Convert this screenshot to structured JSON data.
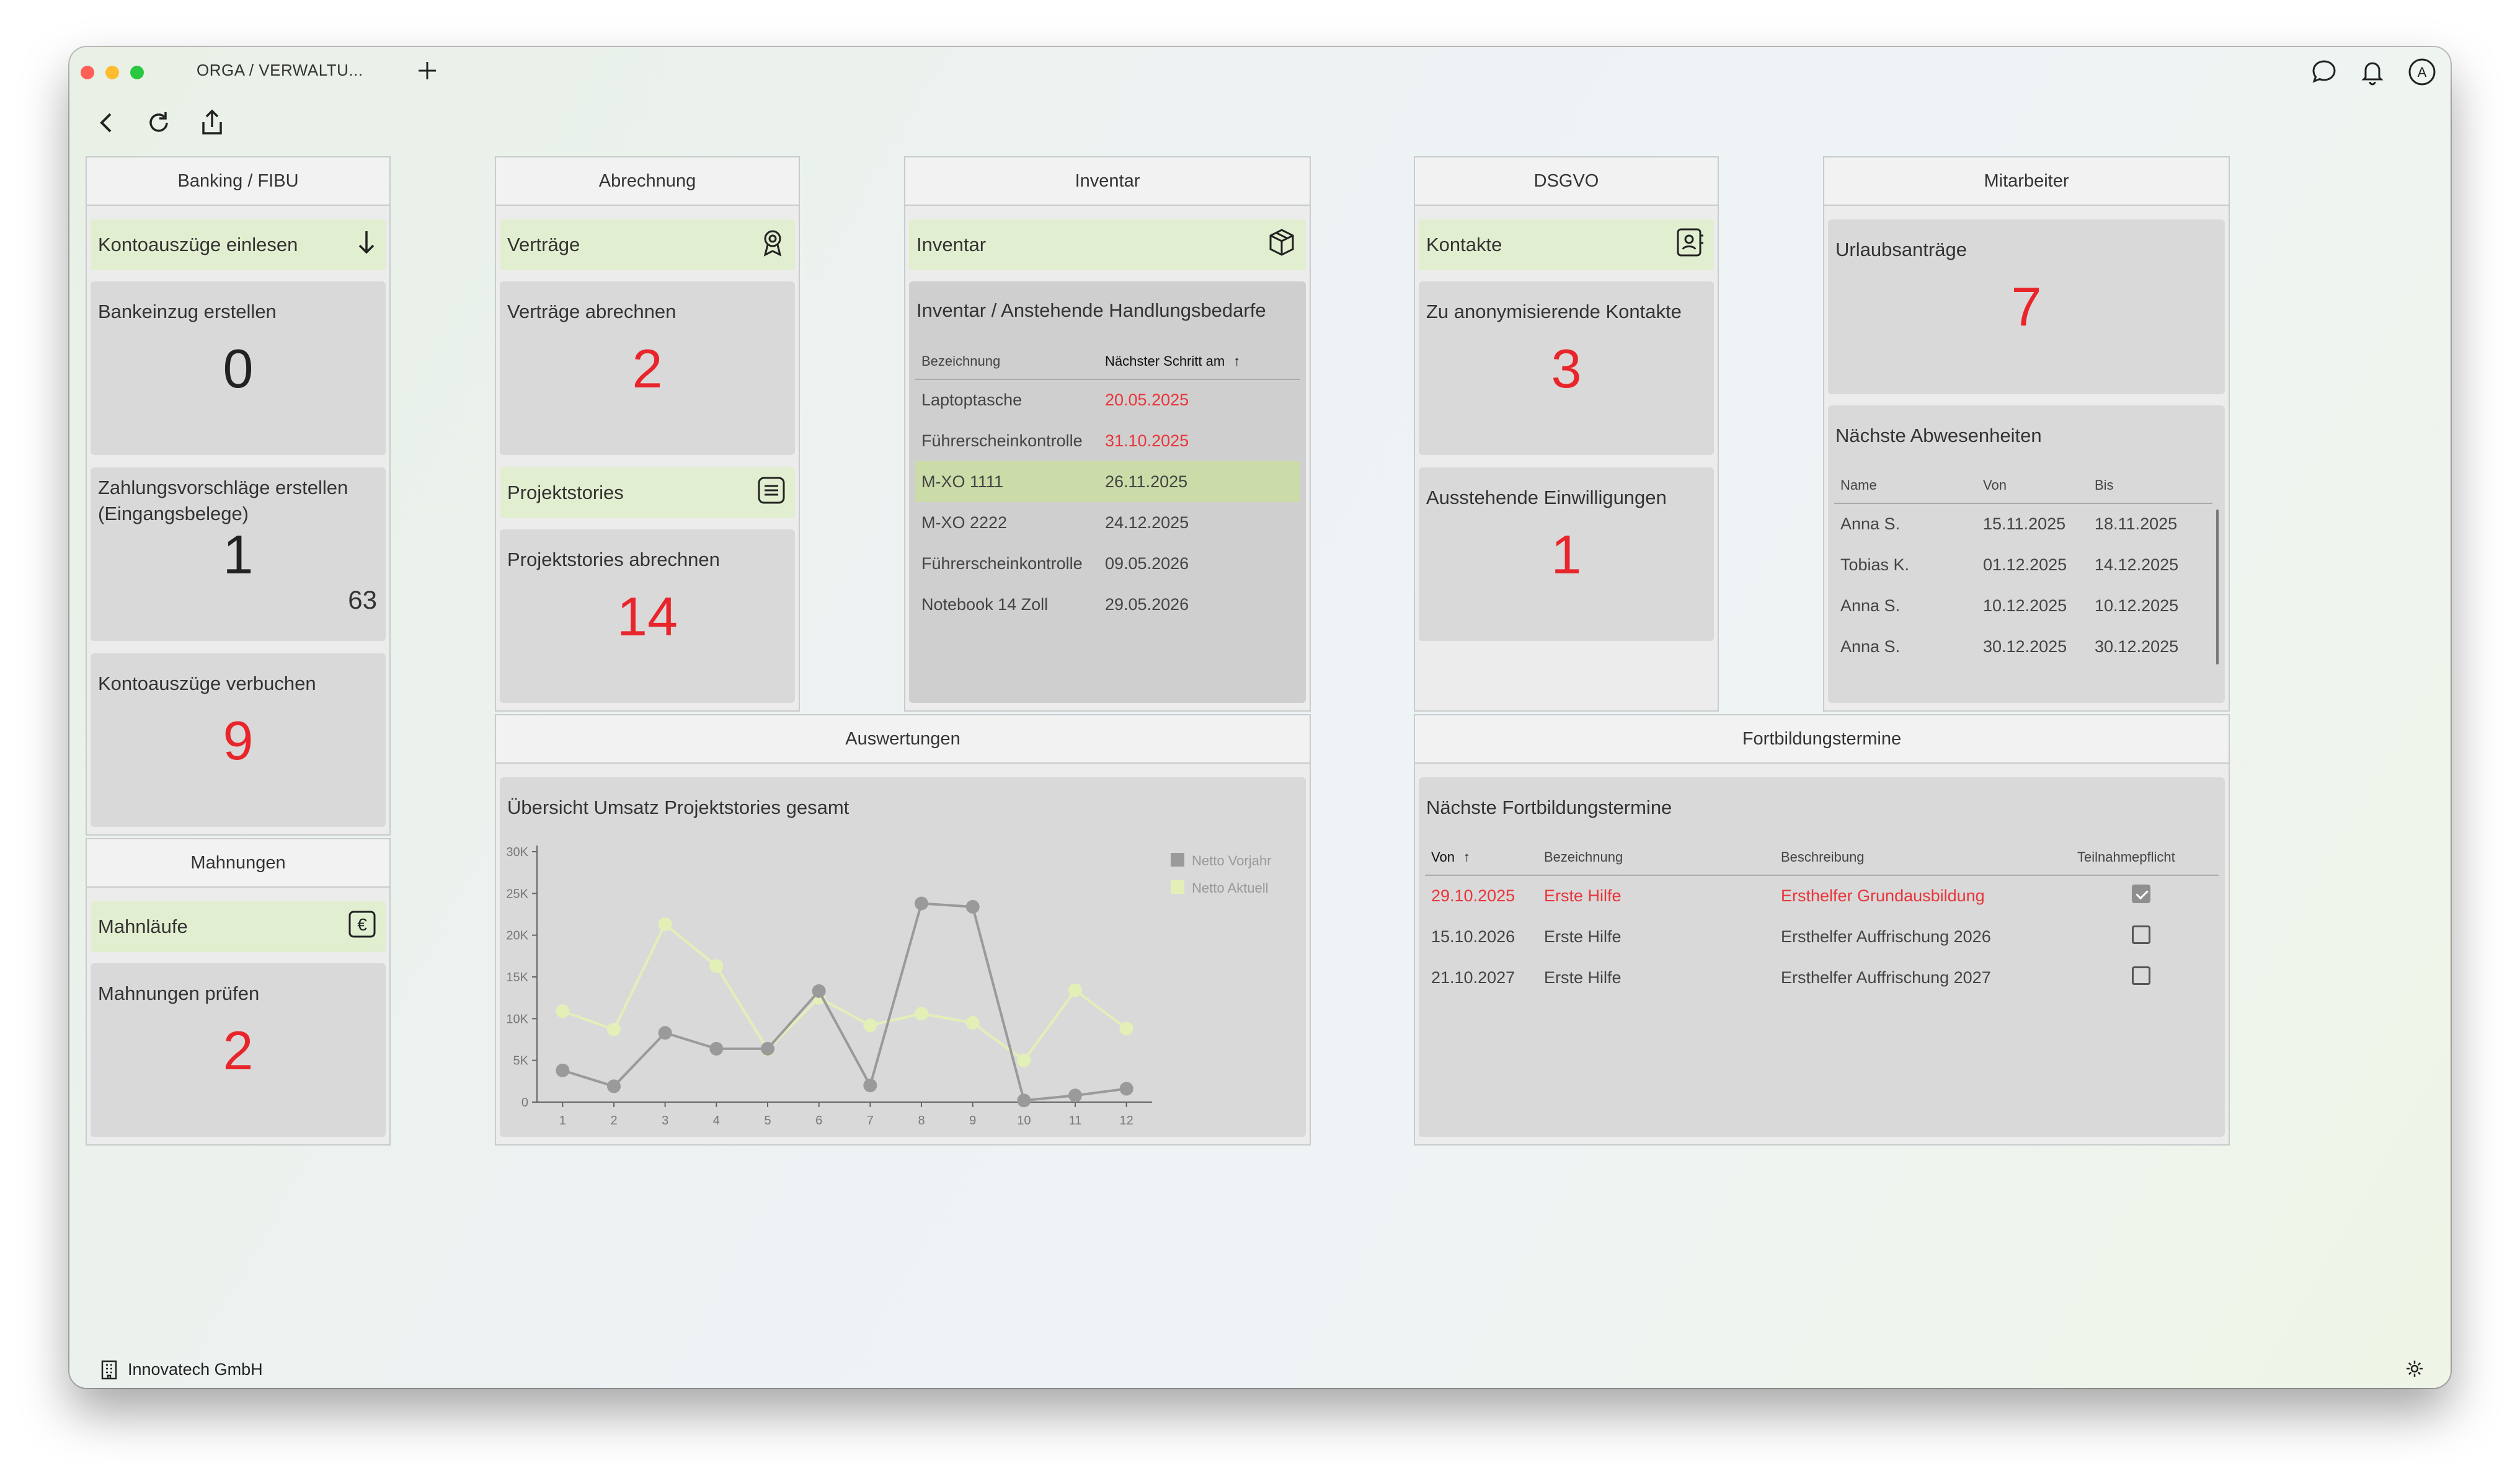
{
  "window": {
    "tab_title": "ORGA / VERWALTU...",
    "company": "Innovatech GmbH"
  },
  "banking": {
    "title": "Banking / FIBU",
    "action": "Kontoauszüge einlesen",
    "tiles": [
      {
        "label": "Bankeinzug erstellen",
        "value": "0"
      },
      {
        "label": "Zahlungsvorschläge erstellen\n(Eingangsbelege)",
        "value": "1",
        "sub": "63"
      },
      {
        "label": "Kontoauszüge verbuchen",
        "value": "9"
      }
    ]
  },
  "mahnungen": {
    "title": "Mahnungen",
    "action": "Mahnläufe",
    "tile": {
      "label": "Mahnungen prüfen",
      "value": "2"
    }
  },
  "abrechnung": {
    "title": "Abrechnung",
    "action1": "Verträge",
    "tile1": {
      "label": "Verträge abrechnen",
      "value": "2"
    },
    "action2": "Projektstories",
    "tile2": {
      "label": "Projektstories abrechnen",
      "value": "14"
    }
  },
  "inventar": {
    "title": "Inventar",
    "action": "Inventar",
    "panel_title": "Inventar / Anstehende Handlungsbedarfe",
    "columns": [
      "Bezeichnung",
      "Nächster Schritt am"
    ],
    "rows": [
      {
        "name": "Laptoptasche",
        "date": "20.05.2025",
        "overdue": true
      },
      {
        "name": "Führerscheinkontrolle",
        "date": "31.10.2025",
        "overdue": true
      },
      {
        "name": "M-XO 1111",
        "date": "26.11.2025",
        "highlight": true
      },
      {
        "name": "M-XO 2222",
        "date": "24.12.2025"
      },
      {
        "name": "Führerscheinkontrolle",
        "date": "09.05.2026"
      },
      {
        "name": "Notebook 14 Zoll",
        "date": "29.05.2026"
      }
    ]
  },
  "dsgvo": {
    "title": "DSGVO",
    "action": "Kontakte",
    "tile1": {
      "label": "Zu anonymisierende Kontakte",
      "value": "3"
    },
    "tile2": {
      "label": "Ausstehende Einwilligungen",
      "value": "1"
    }
  },
  "mitarbeiter": {
    "title": "Mitarbeiter",
    "tile1": {
      "label": "Urlaubsanträge",
      "value": "7"
    },
    "absences_title": "Nächste Abwesenheiten",
    "columns": [
      "Name",
      "Von",
      "Bis"
    ],
    "rows": [
      [
        "Anna S.",
        "15.11.2025",
        "18.11.2025"
      ],
      [
        "Tobias K.",
        "01.12.2025",
        "14.12.2025"
      ],
      [
        "Anna S.",
        "10.12.2025",
        "10.12.2025"
      ],
      [
        "Anna S.",
        "30.12.2025",
        "30.12.2025"
      ]
    ]
  },
  "auswertungen": {
    "title": "Auswertungen",
    "chart_title": "Übersicht Umsatz Projektstories gesamt"
  },
  "chart_data": {
    "type": "line",
    "title": "Übersicht Umsatz Projektstories gesamt",
    "x": [
      "1",
      "2",
      "3",
      "4",
      "5",
      "6",
      "7",
      "8",
      "9",
      "10",
      "11",
      "12"
    ],
    "y_ticks": [
      "0",
      "5K",
      "10K",
      "15K",
      "20K",
      "25K",
      "30K"
    ],
    "ylim": [
      0,
      30000
    ],
    "legend_position": "top-right",
    "series": [
      {
        "name": "Netto Vorjahr",
        "color": "#9a9a9a",
        "values": [
          3800,
          1900,
          8300,
          6400,
          6400,
          13300,
          2000,
          23800,
          23400,
          200,
          800,
          1600
        ]
      },
      {
        "name": "Netto Aktuell",
        "color": "#e2f0b8",
        "values": [
          10900,
          8700,
          21300,
          16300,
          6300,
          12500,
          9200,
          10600,
          9500,
          5000,
          13400,
          8800
        ]
      }
    ]
  },
  "fortbildung": {
    "title": "Fortbildungstermine",
    "panel_title": "Nächste Fortbildungstermine",
    "columns": [
      "Von",
      "Bezeichnung",
      "Beschreibung",
      "Teilnahmepflicht"
    ],
    "rows": [
      {
        "von": "29.10.2025",
        "bez": "Erste Hilfe",
        "desc": "Ersthelfer Grundausbildung",
        "checked": true,
        "overdue": true
      },
      {
        "von": "15.10.2026",
        "bez": "Erste Hilfe",
        "desc": "Ersthelfer Auffrischung 2026",
        "checked": false
      },
      {
        "von": "21.10.2027",
        "bez": "Erste Hilfe",
        "desc": "Ersthelfer Auffrischung 2027",
        "checked": false
      }
    ]
  }
}
